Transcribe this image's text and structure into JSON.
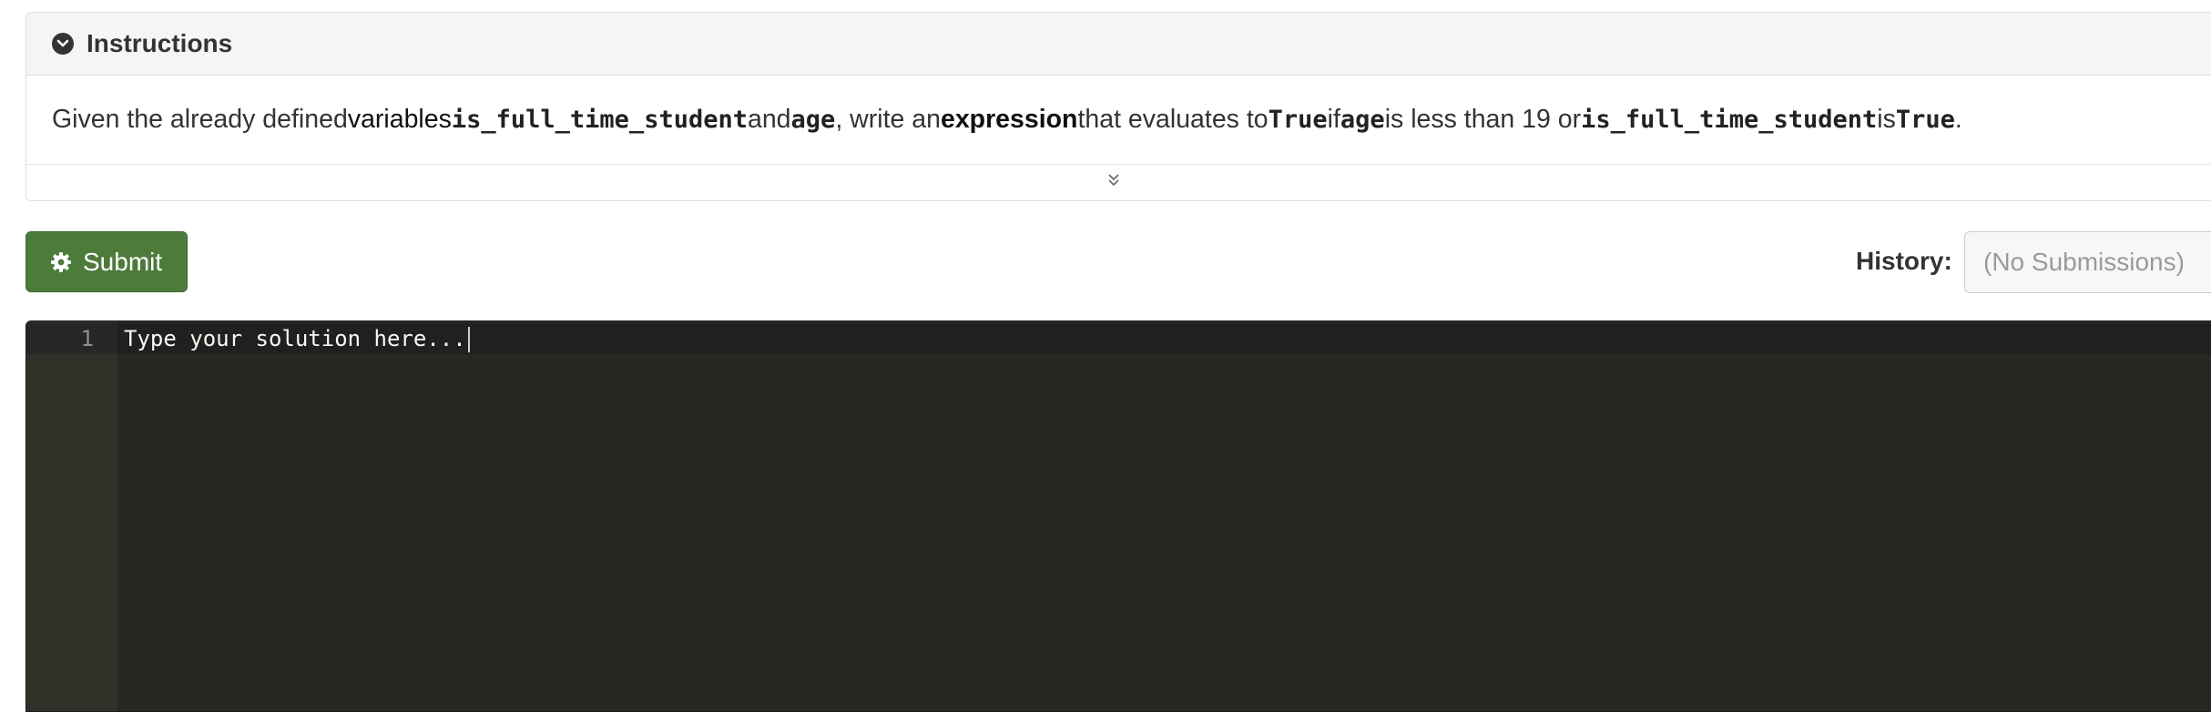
{
  "instructions": {
    "title": "Instructions",
    "text": {
      "t1": "Given the already defined ",
      "t2": "variables",
      "t3": " ",
      "c1": "is_full_time_student",
      "t4": " and ",
      "c2": "age",
      "t5": ", write an ",
      "t6": "expression",
      "t7": " that evaluates to ",
      "c3": "True",
      "t8": " if ",
      "c4": "age",
      "t9": " is less than 19 or ",
      "c5": "is_full_time_student",
      "t10": " is ",
      "c6": "True",
      "t11": "."
    }
  },
  "toolbar": {
    "submit_label": "Submit",
    "history_label": "History:",
    "history_value": "(No Submissions)"
  },
  "editor": {
    "line_number": "1",
    "placeholder": "Type your solution here..."
  },
  "colors": {
    "submit_bg": "#4d7b3c",
    "editor_bg": "#272822",
    "gutter_bg": "#2f3129"
  },
  "icons": {
    "instructions_toggle": "chevron-circle-down-icon",
    "expand": "double-chevron-down-icon",
    "submit": "gear-icon"
  }
}
